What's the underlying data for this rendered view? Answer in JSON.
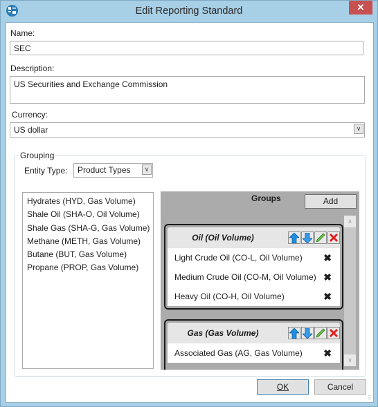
{
  "window": {
    "title": "Edit Reporting Standard",
    "close_label": "✕"
  },
  "form": {
    "name_label": "Name:",
    "name_value": "SEC",
    "description_label": "Description:",
    "description_value": "US Securities and Exchange Commission",
    "currency_label": "Currency:",
    "currency_value": "US dollar"
  },
  "grouping": {
    "title": "Grouping",
    "entity_type_label": "Entity Type:",
    "entity_type_value": "Product Types",
    "available_items": [
      "Hydrates (HYD, Gas Volume)",
      "Shale Oil (SHA-O, Oil Volume)",
      "Shale Gas (SHA-G, Gas Volume)",
      "Methane (METH, Gas Volume)",
      "Butane (BUT, Gas Volume)",
      "Propane (PROP, Gas Volume)"
    ],
    "groups_title": "Groups",
    "add_label": "Add",
    "groups": [
      {
        "name": "Oil (Oil Volume)",
        "members": [
          "Light Crude Oil (CO-L, Oil Volume)",
          "Medium Crude Oil (CO-M, Oil Volume)",
          "Heavy Oil (CO-H, Oil Volume)"
        ]
      },
      {
        "name": "Gas (Gas Volume)",
        "members": [
          "Associated Gas (AG, Gas Volume)"
        ]
      }
    ],
    "remove_glyph": "✖",
    "icons": {
      "up": "arrow-up-icon",
      "down": "arrow-down-icon",
      "edit": "pencil-icon",
      "delete": "delete-icon"
    }
  },
  "buttons": {
    "ok_label": "OK",
    "cancel_label": "Cancel"
  }
}
